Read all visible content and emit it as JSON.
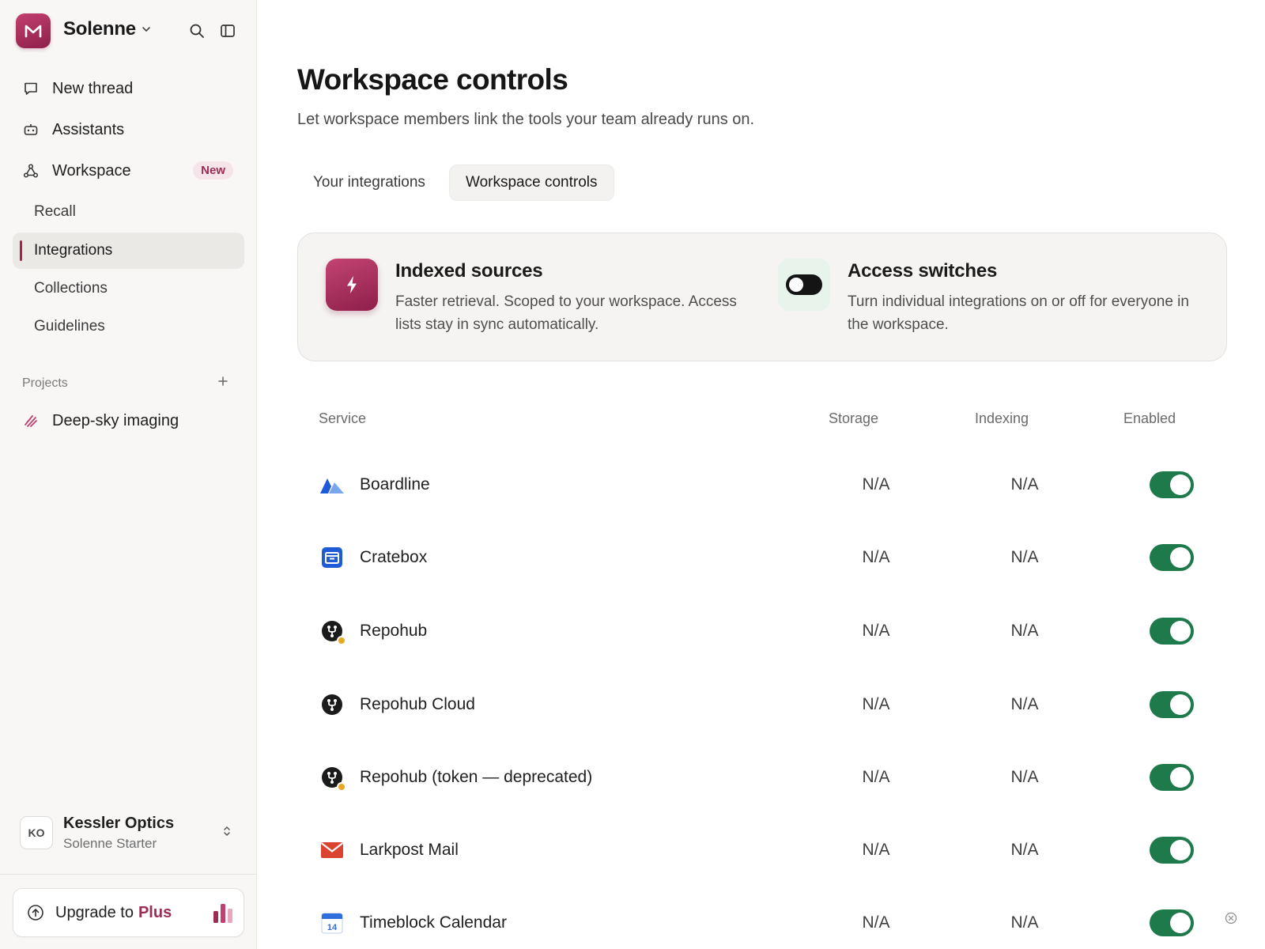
{
  "sidebar": {
    "brand": {
      "name": "Solenne",
      "logo_letter": "M",
      "accent": "#a0264f"
    },
    "nav": [
      {
        "label": "New thread",
        "icon": "chat-bubble-icon"
      },
      {
        "label": "Assistants",
        "icon": "robot-icon"
      },
      {
        "label": "Workspace",
        "icon": "nodes-icon",
        "badge": "New"
      }
    ],
    "workspace_items": [
      {
        "label": "Recall",
        "active": false
      },
      {
        "label": "Integrations",
        "active": true
      },
      {
        "label": "Collections",
        "active": false
      },
      {
        "label": "Guidelines",
        "active": false
      }
    ],
    "projects": {
      "label": "Projects",
      "items": [
        {
          "label": "Deep-sky imaging",
          "icon": "pencil-strokes-icon"
        }
      ]
    },
    "account": {
      "initials": "KO",
      "name": "Kessler Optics",
      "plan": "Solenne Starter"
    },
    "upgrade": {
      "prefix": "Upgrade to",
      "plan": "Plus"
    }
  },
  "main": {
    "title": "Workspace controls",
    "subtitle": "Let workspace members link the tools your team already runs on.",
    "tabs": [
      {
        "label": "Your integrations",
        "active": false
      },
      {
        "label": "Workspace controls",
        "active": true
      }
    ],
    "info": [
      {
        "title": "Indexed sources",
        "desc": "Faster retrieval. Scoped to your workspace. Access lists stay in sync automatically.",
        "icon": "lightning-icon"
      },
      {
        "title": "Access switches",
        "desc": "Turn individual integrations on or off for everyone in the workspace.",
        "icon": "toggle-icon"
      }
    ],
    "table": {
      "columns": {
        "service": "Service",
        "storage": "Storage",
        "indexing": "Indexing",
        "enabled": "Enabled"
      },
      "rows": [
        {
          "name": "Boardline",
          "storage": "N/A",
          "indexing": "N/A",
          "enabled": true,
          "icon": "mountain-logo-icon"
        },
        {
          "name": "Cratebox",
          "storage": "N/A",
          "indexing": "N/A",
          "enabled": true,
          "icon": "box-logo-icon"
        },
        {
          "name": "Repohub",
          "storage": "N/A",
          "indexing": "N/A",
          "enabled": true,
          "icon": "branch-logo-icon",
          "warning": true
        },
        {
          "name": "Repohub Cloud",
          "storage": "N/A",
          "indexing": "N/A",
          "enabled": true,
          "icon": "branch-logo-icon"
        },
        {
          "name": "Repohub (token — deprecated)",
          "storage": "N/A",
          "indexing": "N/A",
          "enabled": true,
          "icon": "branch-logo-icon",
          "warning": true
        },
        {
          "name": "Larkpost Mail",
          "storage": "N/A",
          "indexing": "N/A",
          "enabled": true,
          "icon": "envelope-logo-icon"
        },
        {
          "name": "Timeblock Calendar",
          "storage": "N/A",
          "indexing": "N/A",
          "enabled": true,
          "icon": "calendar-logo-icon",
          "calendar_day": "14"
        }
      ]
    },
    "colors": {
      "toggle_on": "#1f7a4b",
      "warning_dot": "#e8a922"
    }
  }
}
